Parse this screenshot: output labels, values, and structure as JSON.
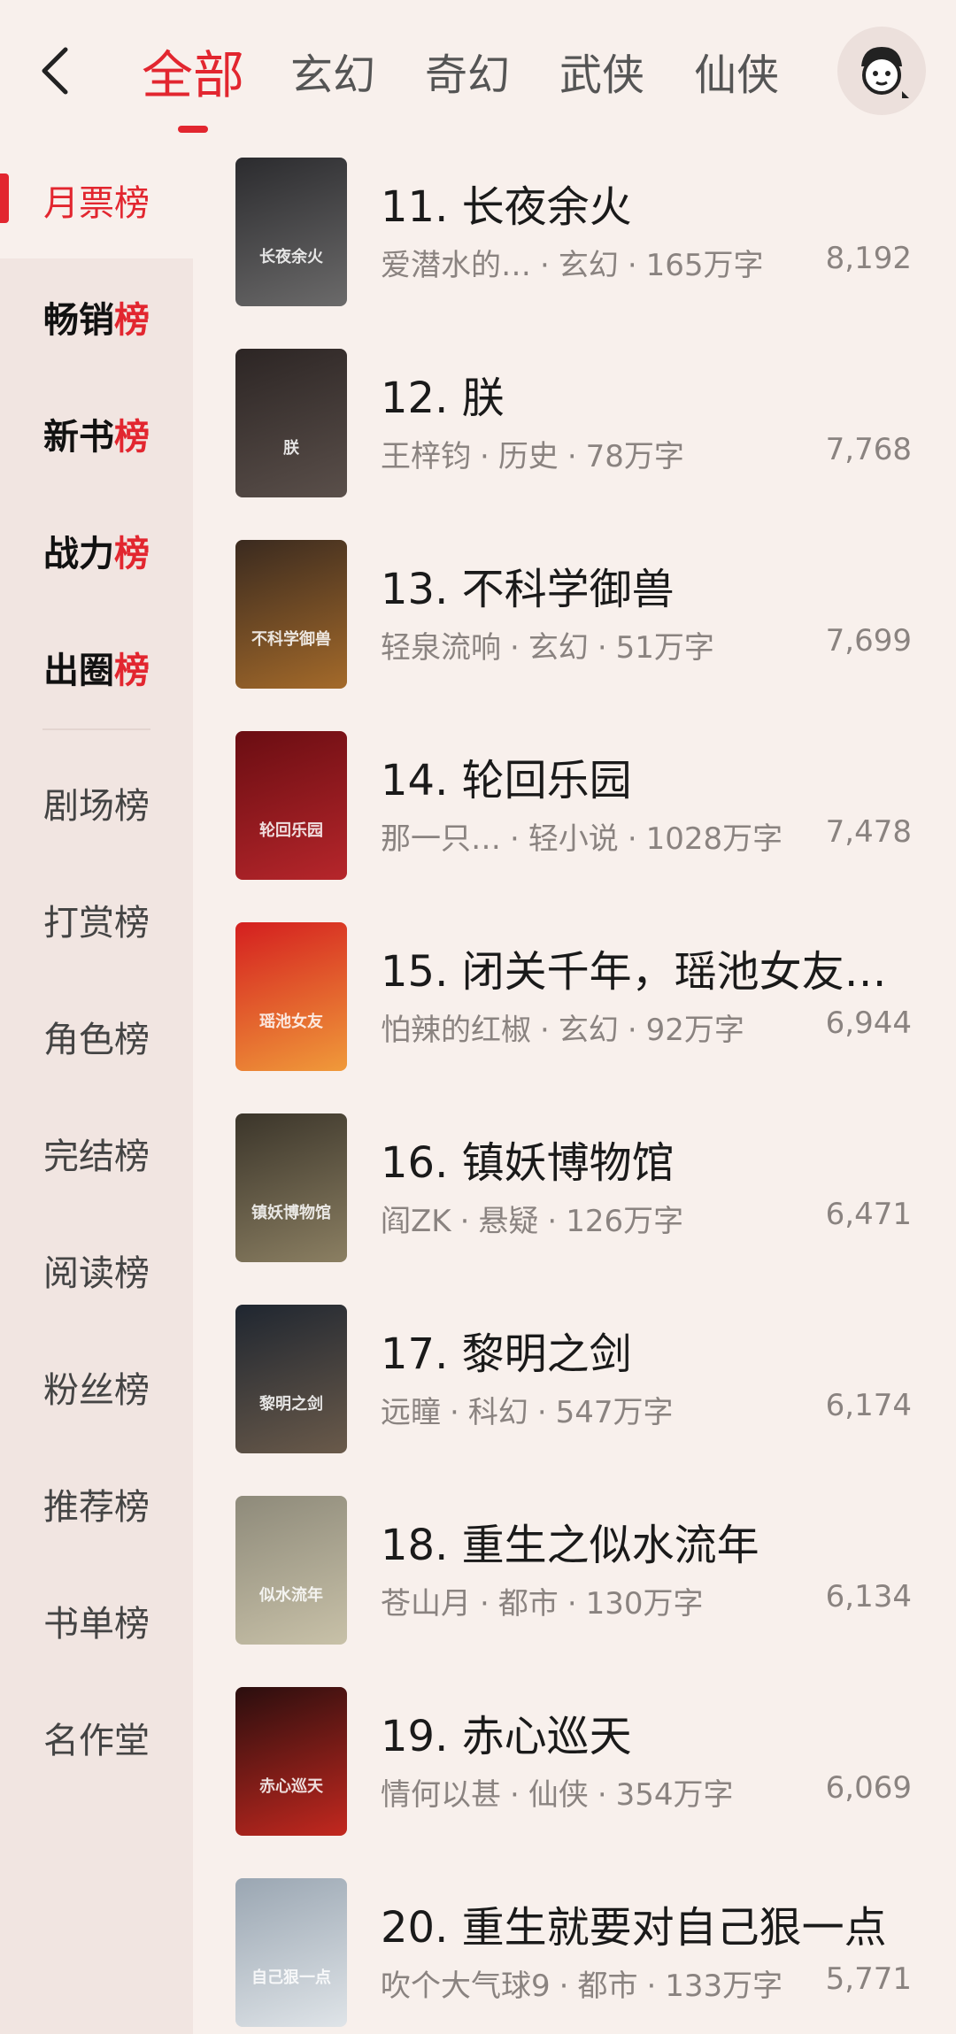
{
  "header": {
    "tabs": [
      "全部",
      "玄幻",
      "奇幻",
      "武侠",
      "仙侠"
    ],
    "active_tab": 0
  },
  "sidebar": {
    "active": [
      "月票榜"
    ],
    "bold": [
      "畅销榜",
      "新书榜",
      "战力榜",
      "出圈榜"
    ],
    "normal": [
      "剧场榜",
      "打赏榜",
      "角色榜",
      "完结榜",
      "阅读榜",
      "粉丝榜",
      "推荐榜",
      "书单榜",
      "名作堂"
    ]
  },
  "books": [
    {
      "title": "11. 长夜余火",
      "author": "爱潜水的…",
      "genre": "玄幻",
      "words": "165万字",
      "count": "8,192",
      "cover_colors": [
        "#2b2b2e",
        "#6b6a6a"
      ],
      "cover_text": "长夜余火"
    },
    {
      "title": "12. 朕",
      "author": "王梓钧",
      "genre": "历史",
      "words": "78万字",
      "count": "7,768",
      "cover_colors": [
        "#2c2524",
        "#5a4f4a"
      ],
      "cover_text": "朕"
    },
    {
      "title": "13. 不科学御兽",
      "author": "轻泉流响",
      "genre": "玄幻",
      "words": "51万字",
      "count": "7,699",
      "cover_colors": [
        "#3a2a1f",
        "#a46a2a"
      ],
      "cover_text": "不科学御兽"
    },
    {
      "title": "14. 轮回乐园",
      "author": "那一只…",
      "genre": "轻小说",
      "words": "1028万字",
      "count": "7,478",
      "cover_colors": [
        "#6a0d12",
        "#b6262b"
      ],
      "cover_text": "轮回乐园"
    },
    {
      "title": "15. 闭关千年，瑶池女友…",
      "author": "怕辣的红椒",
      "genre": "玄幻",
      "words": "92万字",
      "count": "6,944",
      "cover_colors": [
        "#d41f1f",
        "#f09a3a"
      ],
      "cover_text": "瑶池女友"
    },
    {
      "title": "16. 镇妖博物馆",
      "author": "阎ZK",
      "genre": "悬疑",
      "words": "126万字",
      "count": "6,471",
      "cover_colors": [
        "#3b352a",
        "#8b7f62"
      ],
      "cover_text": "镇妖博物馆"
    },
    {
      "title": "17. 黎明之剑",
      "author": "远瞳",
      "genre": "科幻",
      "words": "547万字",
      "count": "6,174",
      "cover_colors": [
        "#1f2630",
        "#6a5a4a"
      ],
      "cover_text": "黎明之剑"
    },
    {
      "title": "18. 重生之似水流年",
      "author": "苍山月",
      "genre": "都市",
      "words": "130万字",
      "count": "6,134",
      "cover_colors": [
        "#8e8a7a",
        "#c8c1a8"
      ],
      "cover_text": "似水流年"
    },
    {
      "title": "19. 赤心巡天",
      "author": "情何以甚",
      "genre": "仙侠",
      "words": "354万字",
      "count": "6,069",
      "cover_colors": [
        "#2a0e0e",
        "#c3281f"
      ],
      "cover_text": "赤心巡天"
    },
    {
      "title": "20. 重生就要对自己狠一点",
      "author": "吹个大气球9",
      "genre": "都市",
      "words": "133万字",
      "count": "5,771",
      "cover_colors": [
        "#9aa6b2",
        "#dfe4e8"
      ],
      "cover_text": "自己狠一点"
    }
  ],
  "colors": {
    "accent": "#e2262f",
    "background": "#f8f0ec",
    "sidebar": "#f1e5e1"
  },
  "icons": {
    "back": "chevron-left-icon",
    "avatar": "avatar-icon"
  }
}
